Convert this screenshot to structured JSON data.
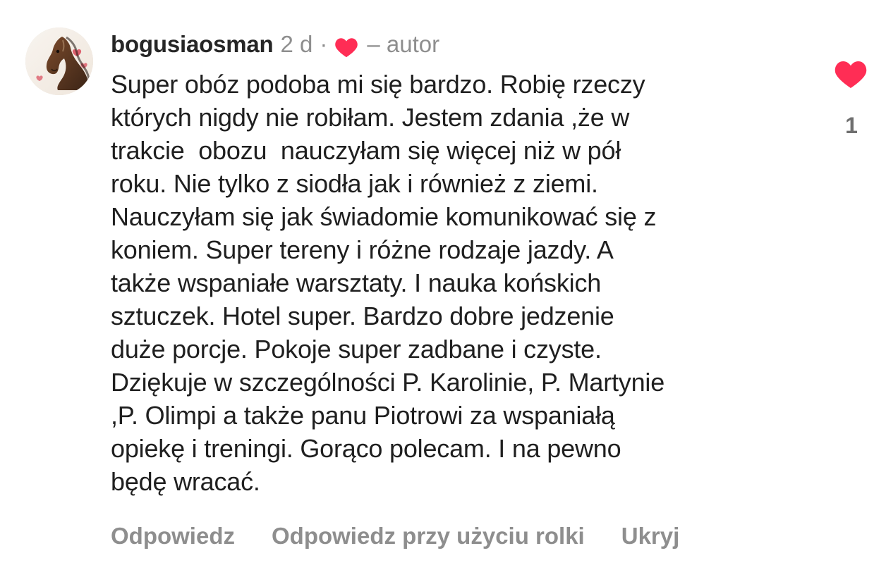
{
  "comment": {
    "username": "bogusiaosman",
    "time": "2 d",
    "separator": "·",
    "author_label": "– autor",
    "body_lines": [
      "Super obóz podoba mi się bardzo. Robię rzeczy",
      "których nigdy nie robiłam. Jestem zdania ,że w",
      "trakcie  obozu  nauczyłam się więcej niż w pół",
      "roku. Nie tylko z siodła jak i również z ziemi.",
      "Nauczyłam się jak świadomie komunikować się z",
      "koniem. Super tereny i różne rodzaje jazdy. A",
      "także wspaniałe warsztaty. I nauka końskich",
      "sztuczek. Hotel super. Bardzo dobre jedzenie",
      "duże porcje. Pokoje super zadbane i czyste.",
      "Dziękuje w szczególności P. Karolinie, P. Martynie",
      ",P. Olimpi a także panu Piotrowi za wspaniałą",
      "opiekę i treningi. Gorąco polecam. I na pewno",
      "będę wracać."
    ],
    "like_count": "1",
    "actions": {
      "reply": "Odpowiedz",
      "reply_reel": "Odpowiedz przy użyciu rolki",
      "hide": "Ukryj"
    }
  },
  "icons": {
    "avatar": "horse-avatar-icon",
    "author_heart": "heart-icon",
    "like_heart": "like-heart-icon"
  },
  "colors": {
    "heart_red": "#ff2d55",
    "meta_gray": "#8e8e8e",
    "text": "#1f1f1f"
  }
}
